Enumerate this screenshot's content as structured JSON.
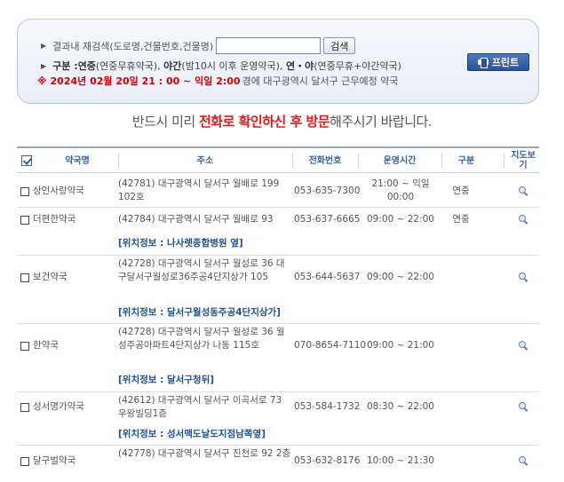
{
  "search": {
    "label": "결과내 재검색(도로명,건물번호,건물명)",
    "input_value": "",
    "button_label": "검색",
    "category_prefix": "구분 : ",
    "category_segments": [
      {
        "text": "연중",
        "bold": true
      },
      {
        "text": "(연중무휴약국), ",
        "bold": false
      },
      {
        "text": "야간",
        "bold": true
      },
      {
        "text": "(밤10시 이후 운영약국), ",
        "bold": false
      },
      {
        "text": "연・야",
        "bold": true
      },
      {
        "text": "(연중무휴+야간약국)",
        "bold": false
      }
    ],
    "notice_red": "※ 2024년 02월 20일 21 : 00 ~ 익일 2:00",
    "notice_rest": "경에  대구광역시  달서구  근무예정 약국",
    "print_label": "프린트"
  },
  "warning": {
    "prefix": "반드시 미리 ",
    "hl1": "전화로 확인하신 후 방문",
    "suffix": "해주시기 바랍니다."
  },
  "table": {
    "headers": {
      "name": "약국명",
      "addr": "주소",
      "phone": "전화번호",
      "time": "운영시간",
      "cat": "구분",
      "map": "지도보기"
    },
    "rows": [
      {
        "name": "상인사랑약국",
        "addr": "(42781) 대구광역시 달서구 월배로 199 102호",
        "phone": "053-635-7300",
        "time": "21:00 ~ 익일 00:00",
        "cat": "연중",
        "loc": ""
      },
      {
        "name": "더편한약국",
        "addr": "(42784) 대구광역시 달서구 월배로 93",
        "phone": "053-637-6665",
        "time": "09:00 ~ 22:00",
        "cat": "연중",
        "loc": "[위치정보 : 나사렛종합병원 옆]"
      },
      {
        "name": "보건약국",
        "addr": "(42728) 대구광역시 달서구 월성로 36 대구달서구월성로36주공4단지상가 105",
        "phone": "053-644-5637",
        "time": "09:00 ~ 22:00",
        "cat": "",
        "loc": "[위치정보 : 달서구월성동주공4단지상가]"
      },
      {
        "name": "한약국",
        "addr": "(42728) 대구광역시 달서구 월성로 36 월성주공아파트4단지상가 나동 115호",
        "phone": "070-8654-7110",
        "time": "09:00 ~ 21:00",
        "cat": "",
        "loc": "[위치정보 : 달서구청뒤]"
      },
      {
        "name": "성서명가약국",
        "addr": "(42612) 대구광역시 달서구 이곡서로 73 우왕빌딩1층",
        "phone": "053-584-1732",
        "time": "08:30 ~ 22:00",
        "cat": "",
        "loc": "[위치정보 : 성서맥도날도지점남쪽옆]"
      },
      {
        "name": "달구벌약국",
        "addr": "(42778) 대구광역시 달서구 진천로 92 2층",
        "phone": "053-632-8176",
        "time": "10:00 ~ 21:30",
        "cat": "",
        "loc": ""
      }
    ]
  },
  "colors": {
    "accent_blue": "#3d5f98",
    "notice_red": "#d80000",
    "print_button": "#2a539a"
  },
  "icons": {
    "header_check": "checkbox-checked-icon",
    "row_check": "checkbox-icon",
    "map": "magnifier-icon",
    "print": "printer-icon"
  }
}
